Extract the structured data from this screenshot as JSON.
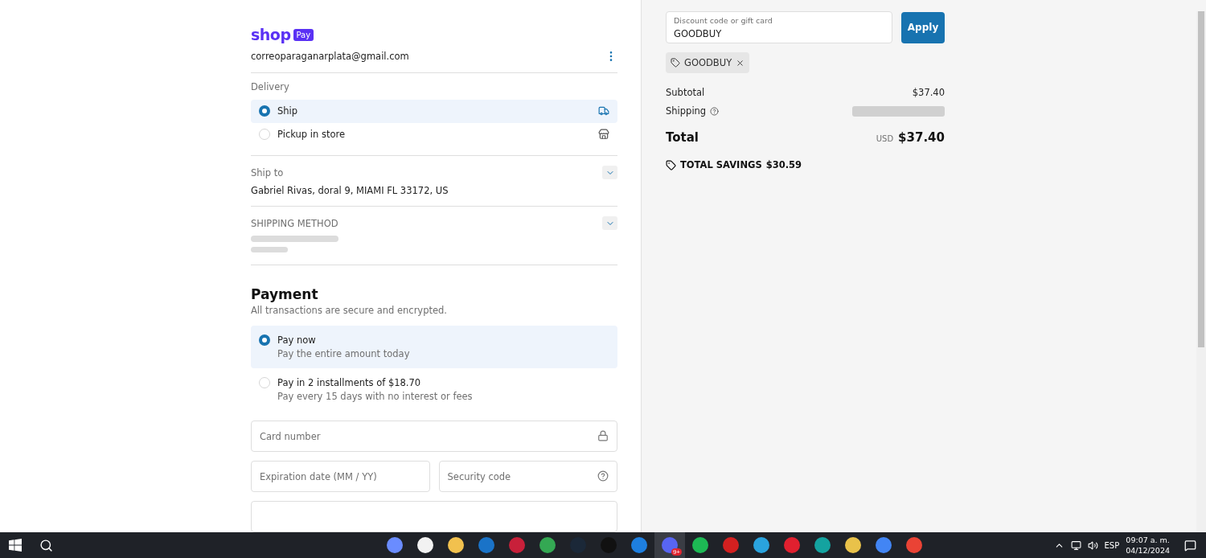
{
  "checkout": {
    "logo": {
      "word": "shop",
      "badge": "Pay"
    },
    "email": "correoparaganarplata@gmail.com",
    "delivery": {
      "label": "Delivery",
      "options": [
        {
          "label": "Ship",
          "selected": true,
          "kind": "truck"
        },
        {
          "label": "Pickup in store",
          "selected": false,
          "kind": "store"
        }
      ]
    },
    "ship_to": {
      "label": "Ship to",
      "address": "Gabriel Rivas, doral 9, MIAMI FL 33172, US"
    },
    "shipping_method": {
      "label": "SHIPPING METHOD"
    },
    "payment": {
      "title": "Payment",
      "subtitle": "All transactions are secure and encrypted.",
      "options": [
        {
          "label": "Pay now",
          "detail": "Pay the entire amount today",
          "selected": true
        },
        {
          "label": "Pay in 2 installments of $18.70",
          "detail": "Pay every 15 days with no interest or fees",
          "selected": false
        }
      ],
      "fields": [
        {
          "placeholder": "Card number",
          "kind": "lock"
        },
        {
          "placeholder": "Expiration date (MM / YY)",
          "kind": "plain"
        },
        {
          "placeholder": "Security code",
          "kind": "help"
        }
      ]
    }
  },
  "summary": {
    "discount": {
      "label": "Discount code or gift card",
      "value": "GOODBUY",
      "button": "Apply"
    },
    "applied_code": "GOODBUY",
    "subtotal": {
      "label": "Subtotal",
      "value": "$37.40"
    },
    "shipping": {
      "label": "Shipping"
    },
    "total": {
      "label": "Total",
      "currency": "USD",
      "value": "$37.40"
    },
    "savings": {
      "label": "TOTAL SAVINGS",
      "value": "$30.59"
    }
  },
  "taskbar": {
    "apps": [
      {
        "color": "#6a8cff",
        "selected": false
      },
      {
        "color": "#f2f2f2",
        "selected": false
      },
      {
        "color": "#f2c14e",
        "selected": false
      },
      {
        "color": "#1a73c8",
        "selected": false
      },
      {
        "color": "#c8203a",
        "selected": false
      },
      {
        "color": "#34a853",
        "selected": false
      },
      {
        "color": "#1b2838",
        "selected": false
      },
      {
        "color": "#111111",
        "selected": false
      },
      {
        "color": "#1e7fe0",
        "selected": false
      },
      {
        "color": "#5865f2",
        "selected": true,
        "badge": "9+"
      },
      {
        "color": "#1db954",
        "selected": false
      },
      {
        "color": "#d32020",
        "selected": false
      },
      {
        "color": "#2aa3de",
        "selected": false
      },
      {
        "color": "#e0202f",
        "selected": false
      },
      {
        "color": "#14a3a0",
        "selected": false
      },
      {
        "color": "#e9c24a",
        "selected": false
      },
      {
        "color": "#4285f4",
        "selected": false
      },
      {
        "color": "#ea4335",
        "selected": false
      }
    ],
    "language": "ESP",
    "time": "09:07 a. m.",
    "date": "04/12/2024"
  }
}
